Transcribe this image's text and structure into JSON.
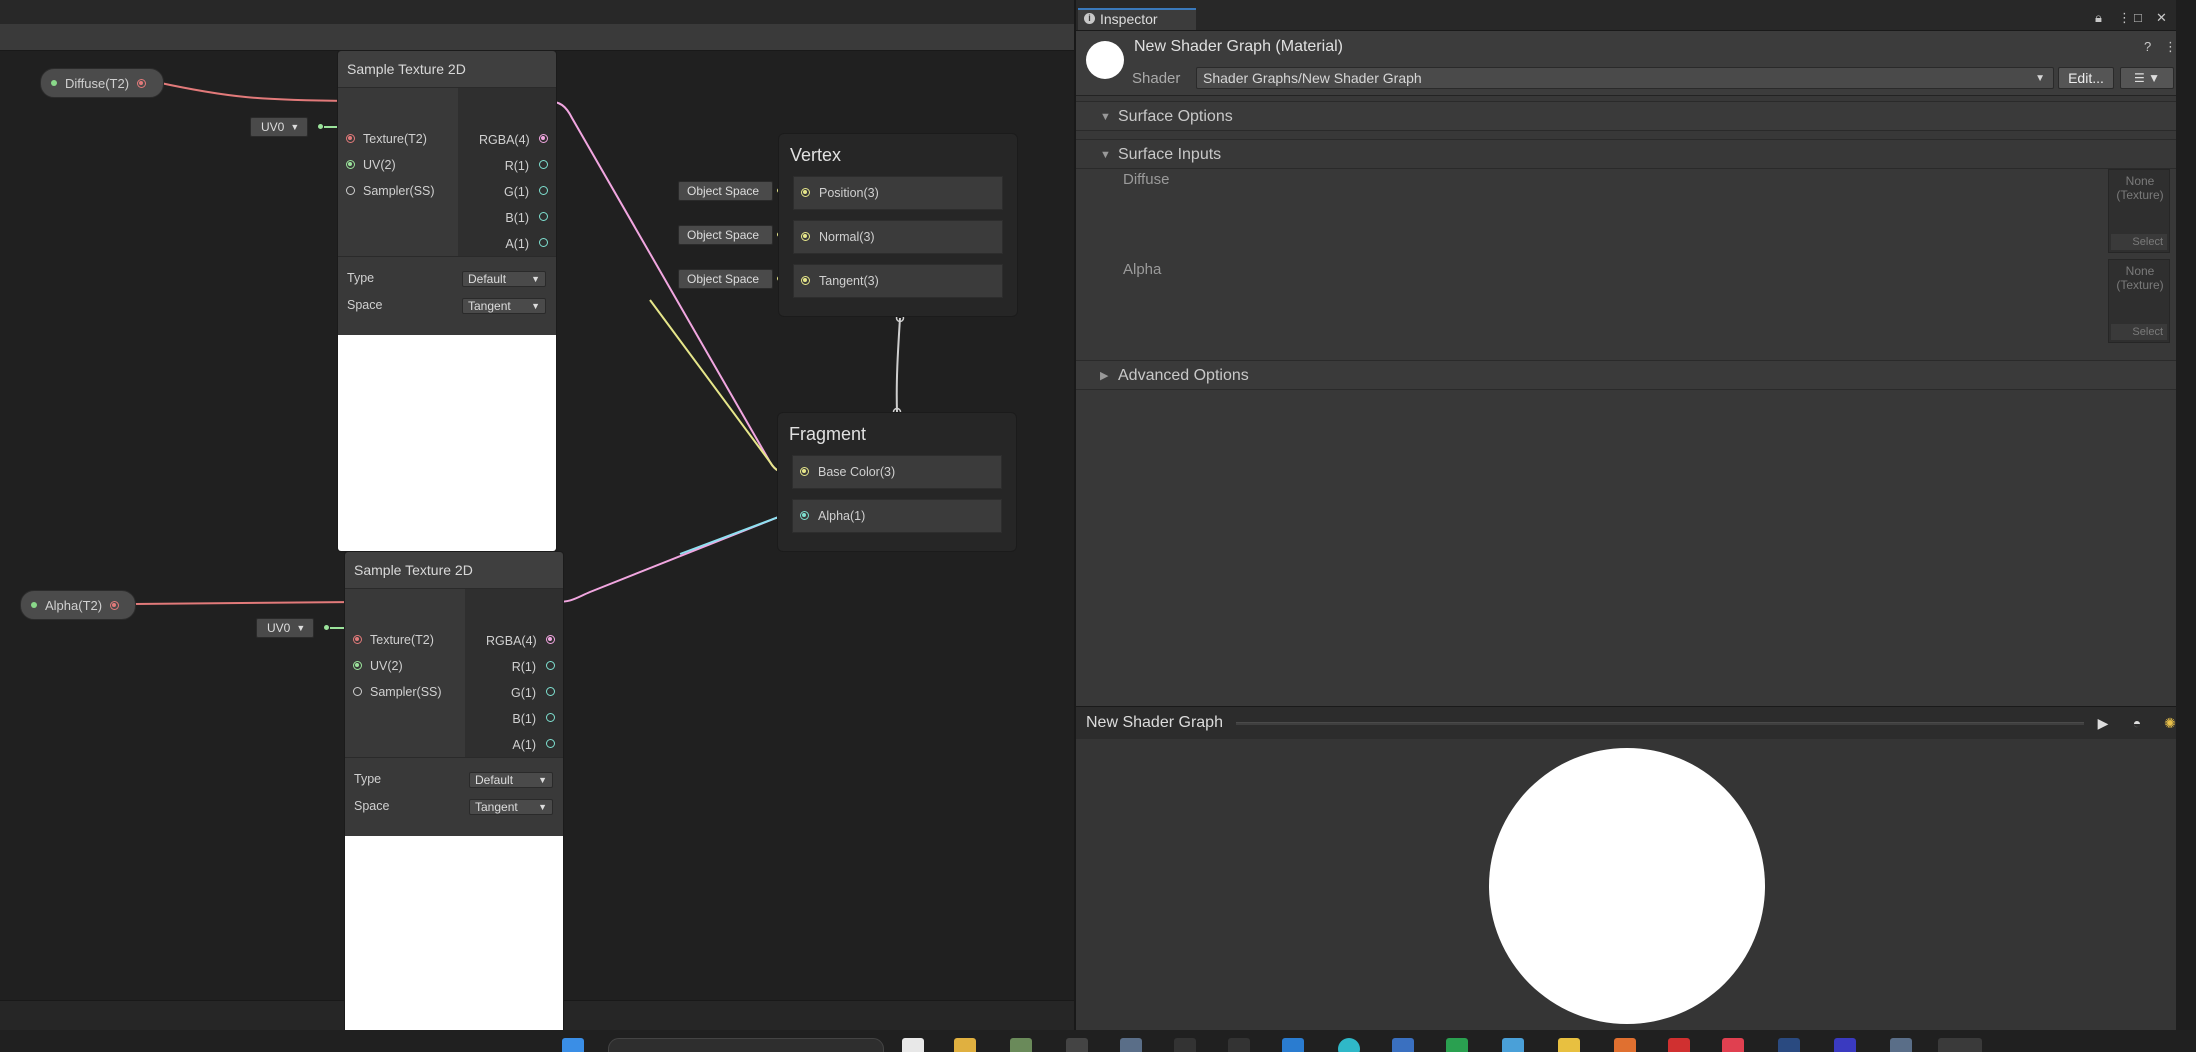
{
  "graph": {
    "properties": [
      {
        "label": "Diffuse(T2)"
      },
      {
        "label": "Alpha(T2)"
      }
    ],
    "nodes": [
      {
        "title": "Sample Texture 2D",
        "inputs": [
          "Texture(T2)",
          "UV(2)",
          "Sampler(SS)"
        ],
        "outputs": [
          "RGBA(4)",
          "R(1)",
          "G(1)",
          "B(1)",
          "A(1)"
        ],
        "uv": "UV0",
        "type_label": "Type",
        "type_value": "Default",
        "space_label": "Space",
        "space_value": "Tangent"
      },
      {
        "title": "Sample Texture 2D",
        "inputs": [
          "Texture(T2)",
          "UV(2)",
          "Sampler(SS)"
        ],
        "outputs": [
          "RGBA(4)",
          "R(1)",
          "G(1)",
          "B(1)",
          "A(1)"
        ],
        "uv": "UV0",
        "type_label": "Type",
        "type_value": "Default",
        "space_label": "Space",
        "space_value": "Tangent"
      }
    ],
    "vertex": {
      "title": "Vertex",
      "slots": [
        "Position(3)",
        "Normal(3)",
        "Tangent(3)"
      ],
      "space": "Object Space"
    },
    "fragment": {
      "title": "Fragment",
      "slots": [
        "Base Color(3)",
        "Alpha(1)"
      ]
    },
    "colors": {
      "texture_wire": "#e27a7a",
      "rgba_wire": "#f1a6e0",
      "vector3_wire": "#e6e68a",
      "float_wire": "#8ee0f0",
      "uv_wire": "#9be39b"
    }
  },
  "inspector": {
    "tab": "Inspector",
    "material_title": "New Shader Graph (Material)",
    "shader_label": "Shader",
    "shader_value": "Shader Graphs/New Shader Graph",
    "edit_label": "Edit...",
    "sections": {
      "surface_options": "Surface Options",
      "surface_inputs": "Surface Inputs",
      "advanced_options": "Advanced Options"
    },
    "textures": [
      {
        "label": "Diffuse",
        "none": "None",
        "type": "(Texture)",
        "select": "Select"
      },
      {
        "label": "Alpha",
        "none": "None",
        "type": "(Texture)",
        "select": "Select"
      }
    ],
    "preview": {
      "title": "New Shader Graph"
    }
  }
}
